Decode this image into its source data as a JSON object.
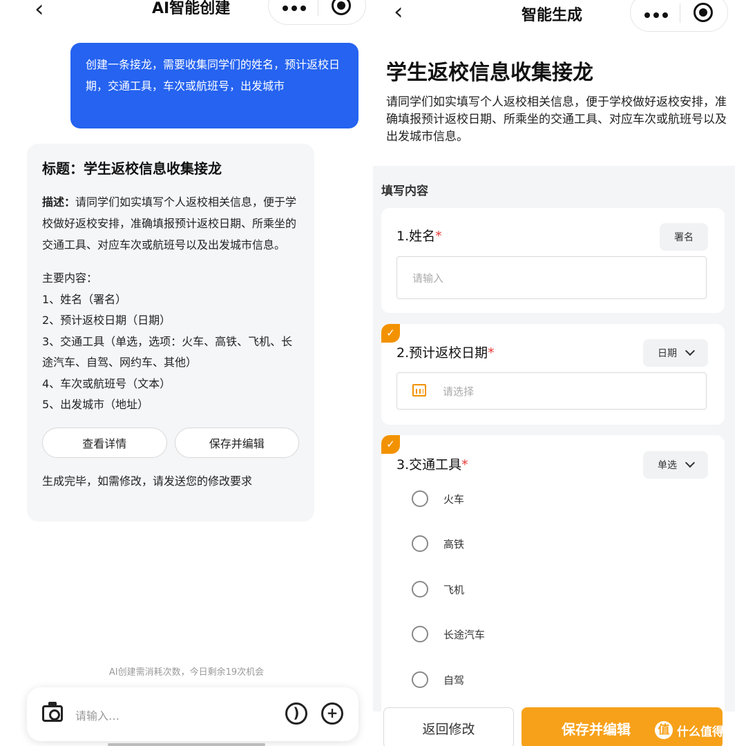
{
  "left": {
    "header": {
      "back_icon": "‹",
      "title": "AI智能创建"
    },
    "user_message": "创建一条接龙，需要收集同学们的姓名，预计返校日期，交通工具，车次或航班号，出发城市",
    "ai_reply": {
      "title": "标题：学生返校信息收集接龙",
      "desc_label": "描述：",
      "desc_text": "请同学们如实填写个人返校相关信息，便于学校做好返校安排，准确填报预计返校日期、所乘坐的交通工具、对应车次或航班号以及出发城市信息。",
      "content_heading": "主要内容：",
      "items": [
        "1、姓名（署名）",
        "2、预计返校日期（日期）",
        "3、交通工具（单选，选项：火车、高铁、飞机、长途汽车、自驾、网约车、其他）",
        "4、车次或航班号（文本）",
        "5、出发城市（地址）"
      ],
      "view_details_label": "查看详情",
      "save_edit_label": "保存并编辑",
      "footer": "生成完毕，如需修改，请发送您的修改要求"
    },
    "quota_text": "AI创建需消耗次数，今日剩余19次机会",
    "input": {
      "placeholder": "请输入…"
    }
  },
  "right": {
    "header": {
      "back_icon": "‹",
      "title": "智能生成"
    },
    "form_title": "学生返校信息收集接龙",
    "form_desc": "请同学们如实填写个人返校相关信息，便于学校做好返校安排，准确填报预计返校日期、所乘坐的交通工具、对应车次或航班号以及出发城市信息。",
    "section_label": "填写内容",
    "q1": {
      "label": "1.姓名",
      "required": "*",
      "tag": "署名",
      "placeholder": "请输入"
    },
    "q2": {
      "label": "2.预计返校日期",
      "required": "*",
      "tag": "日期",
      "placeholder": "请选择"
    },
    "q3": {
      "label": "3.交通工具",
      "required": "*",
      "tag": "单选",
      "options": [
        "火车",
        "高铁",
        "飞机",
        "长途汽车",
        "自驾"
      ]
    },
    "back_button": "返回修改",
    "save_button": "保存并编辑",
    "watermark": "什么值得买"
  },
  "colors": {
    "user_bubble": "#2563f0",
    "accent_orange": "#f39200",
    "required_red": "#e53935"
  }
}
